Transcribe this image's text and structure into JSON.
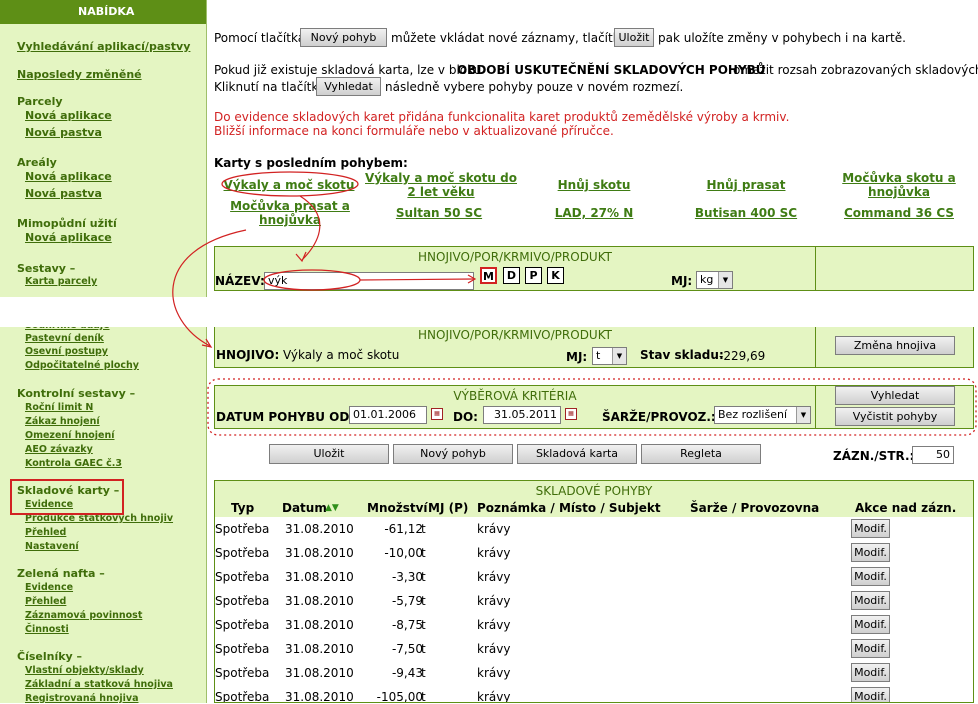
{
  "sidebar": {
    "title": "NABÍDKA",
    "vyhledavani": "Vyhledávání aplikací/pastvy",
    "naposledy": "Naposledy změněné",
    "parcely": "Parcely",
    "parcely_nova_aplikace": "Nová aplikace",
    "parcely_nova_pastva": "Nová pastva",
    "arealy": "Areály",
    "arealy_nova_aplikace": "Nová aplikace",
    "arealy_nova_pastva": "Nová pastva",
    "mimopudni": "Mimopůdní užití",
    "mimopudni_nova_aplikace": "Nová aplikace",
    "sestavy": "Sestavy –",
    "karta_parcely": "Karta parcely",
    "souhrnne": "Souhrnné údaje",
    "pastevni": "Pastevní deník",
    "osevni": "Osevní postupy",
    "odpocitatelne": "Odpočitatelné plochy",
    "kontrolni": "Kontrolní sestavy –",
    "rocni_limit": "Roční limit N",
    "zakaz": "Zákaz hnojení",
    "omezeni": "Omezení hnojení",
    "aeo": "AEO závazky",
    "gaec": "Kontrola GAEC č.3",
    "skladove": "Skladové karty –",
    "evidence": "Evidence",
    "produkce": "Produkce statkových hnojiv",
    "prehled": "Přehled",
    "nastaveni": "Nastavení",
    "zelena": "Zelená nafta –",
    "zn_evidence": "Evidence",
    "zn_prehled": "Přehled",
    "zn_zaznamova": "Záznamová povinnost",
    "zn_cinnosti": "Činnosti",
    "ciselniky": "Číselníky –",
    "vlastni": "Vlastní objekty/sklady",
    "zakladni": "Základní a statková hnojiva",
    "registrovana": "Registrovaná hnojiva"
  },
  "intro": {
    "l1a": "Pomocí tlačítka",
    "btn_novy": "Nový pohyb",
    "l1b": "můžete vkládat nové záznamy, tlačítkem",
    "btn_ulozit": "Uložit",
    "l1c": "pak uložíte změny v pohybech i na kartě.",
    "l2a": "Pokud již existuje skladová karta, lze v bloku",
    "l2b": "OBDOBÍ USKUTEČNĚNÍ SKLADOVÝCH POHYBŮ",
    "l2c": "omezit rozsah zobrazovaných skladových poh",
    "l3a": "Kliknutí na tlačítko",
    "btn_vyhledat": "Vyhledat",
    "l3b": "následně vybere pohyby pouze v novém rozmezí.",
    "red1": "Do evidence skladových karet přidána funkcionalita karet produktů zemědělské výroby a krmiv.",
    "red2": "Bližší informace na konci formuláře nebo v aktualizované příručce.",
    "karty_title": "Karty s posledním pohybem:"
  },
  "recent_cards": [
    "Výkaly a moč skotu",
    "Výkaly a moč skotu do 2 let věku",
    "Hnůj skotu",
    "Hnůj prasat",
    "Močůvka skotu a hnojůvka",
    "Močůvka prasat a hnojůvka",
    "Sultan 50 SC",
    "LAD, 27% N",
    "Butisan 400 SC",
    "Command 36 CS"
  ],
  "search_panel": {
    "title": "HNOJIVO/POR/KRMIVO/PRODUKT",
    "name_label": "NÁZEV:",
    "name_value": "výk",
    "btn_m": "M",
    "btn_d": "D",
    "btn_p": "P",
    "btn_k": "K",
    "mj_label": "MJ:",
    "mj_value": "kg"
  },
  "selected_panel": {
    "title": "HNOJIVO/POR/KRMIVO/PRODUKT",
    "hnojivo_label": "HNOJIVO:",
    "hnojivo_value": "Výkaly a moč skotu",
    "mj_label": "MJ:",
    "mj_value": "t",
    "stav_label": "Stav skladu:",
    "stav_value": "-229,69",
    "btn_zmena": "Změna hnojiva"
  },
  "criteria": {
    "title": "VÝBĚROVÁ KRITÉRIA",
    "datum_label": "DATUM POHYBU OD:",
    "datum_od": "01.01.2006",
    "do_label": "DO:",
    "datum_do": "31.05.2011",
    "sarze_label": "ŠARŽE/PROVOZ.:",
    "sarze_value": "Bez rozlišení",
    "btn_vyhledat": "Vyhledat",
    "btn_vycistit": "Vyčistit pohyby"
  },
  "actions": {
    "ulozit": "Uložit",
    "novy": "Nový pohyb",
    "skladova": "Skladová karta",
    "regleta": "Regleta",
    "zazn_label": "ZÁZN./STR.:",
    "zazn_value": "50"
  },
  "grid": {
    "title": "SKLADOVÉ POHYBY",
    "headers": [
      "Typ",
      "Datum",
      "Množství",
      "MJ (P)",
      "Poznámka / Místo / Subjekt",
      "Šarže / Provozovna",
      "Akce nad zázn."
    ],
    "sort_icon": "▲▼",
    "rows": [
      {
        "typ": "Spotřeba",
        "datum": "31.08.2010",
        "mnozstvi": "-61,12",
        "mj": "t",
        "poznamka": "krávy",
        "akce": "Modif."
      },
      {
        "typ": "Spotřeba",
        "datum": "31.08.2010",
        "mnozstvi": "-10,00",
        "mj": "t",
        "poznamka": "krávy",
        "akce": "Modif."
      },
      {
        "typ": "Spotřeba",
        "datum": "31.08.2010",
        "mnozstvi": "-3,30",
        "mj": "t",
        "poznamka": "krávy",
        "akce": "Modif."
      },
      {
        "typ": "Spotřeba",
        "datum": "31.08.2010",
        "mnozstvi": "-5,79",
        "mj": "t",
        "poznamka": "krávy",
        "akce": "Modif."
      },
      {
        "typ": "Spotřeba",
        "datum": "31.08.2010",
        "mnozstvi": "-8,75",
        "mj": "t",
        "poznamka": "krávy",
        "akce": "Modif."
      },
      {
        "typ": "Spotřeba",
        "datum": "31.08.2010",
        "mnozstvi": "-7,50",
        "mj": "t",
        "poznamka": "krávy",
        "akce": "Modif."
      },
      {
        "typ": "Spotřeba",
        "datum": "31.08.2010",
        "mnozstvi": "-9,43",
        "mj": "t",
        "poznamka": "krávy",
        "akce": "Modif."
      },
      {
        "typ": "Spotřeba",
        "datum": "31.08.2010",
        "mnozstvi": "-105,00",
        "mj": "t",
        "poznamka": "krávy",
        "akce": "Modif."
      }
    ]
  }
}
